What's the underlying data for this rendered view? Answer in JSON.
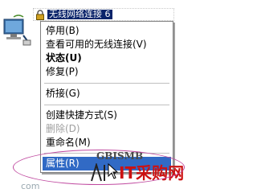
{
  "connection": {
    "title": "无线网络连接 6"
  },
  "menu": {
    "items": [
      {
        "label": "停用(B)",
        "bold": false,
        "disabled": false
      },
      {
        "label": "查看可用的无线连接(V)",
        "bold": false,
        "disabled": false
      },
      {
        "label": "状态(U)",
        "bold": true,
        "disabled": false
      },
      {
        "label": "修复(P)",
        "bold": false,
        "disabled": false
      },
      {
        "label": "桥接(G)",
        "bold": false,
        "disabled": false
      },
      {
        "label": "创建快捷方式(S)",
        "bold": false,
        "disabled": false
      },
      {
        "label": "删除(D)",
        "bold": false,
        "disabled": true
      },
      {
        "label": "重命名(M)",
        "bold": false,
        "disabled": false
      },
      {
        "label": "属性(R)",
        "bold": false,
        "disabled": false,
        "selected": true
      }
    ]
  },
  "watermark": {
    "brand": "GBISMB",
    "it_label": "IT采购网",
    "site": "com"
  },
  "icons": {
    "network": "network-connection-icon",
    "lock": "lock-icon",
    "cursor": "mouse-cursor-icon"
  },
  "colors": {
    "selection": "#316ac5",
    "highlight_oval": "#c04aa0",
    "title_highlight": "#0a246a"
  }
}
